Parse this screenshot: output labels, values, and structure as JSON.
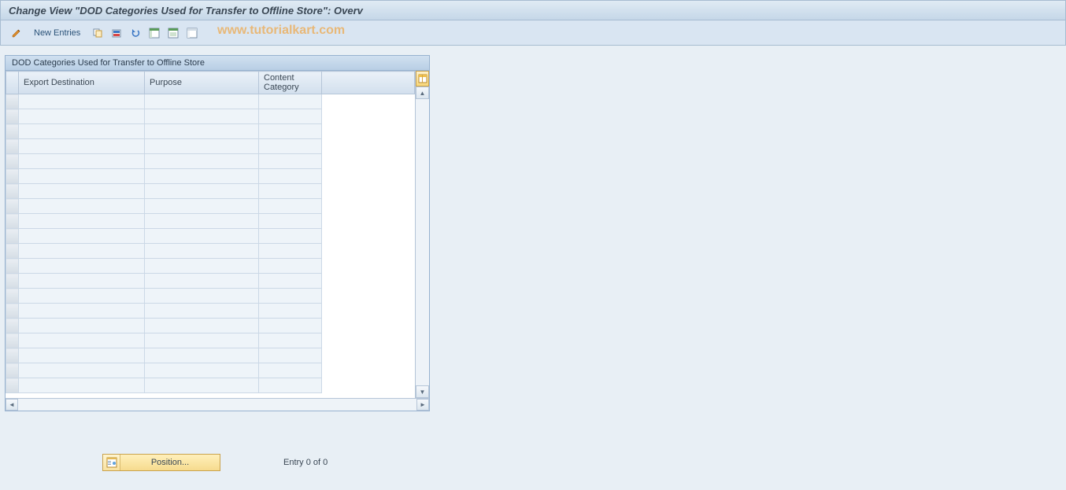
{
  "title": "Change View \"DOD Categories Used for Transfer to Offline Store\": Overv",
  "toolbar": {
    "new_entries": "New Entries"
  },
  "watermark": "www.tutorialkart.com",
  "panel": {
    "title": "DOD Categories Used for Transfer to Offline Store",
    "columns": [
      "Export Destination",
      "Purpose",
      "Content Category"
    ],
    "row_count": 20
  },
  "footer": {
    "position_label": "Position...",
    "entry_status": "Entry 0 of 0"
  }
}
